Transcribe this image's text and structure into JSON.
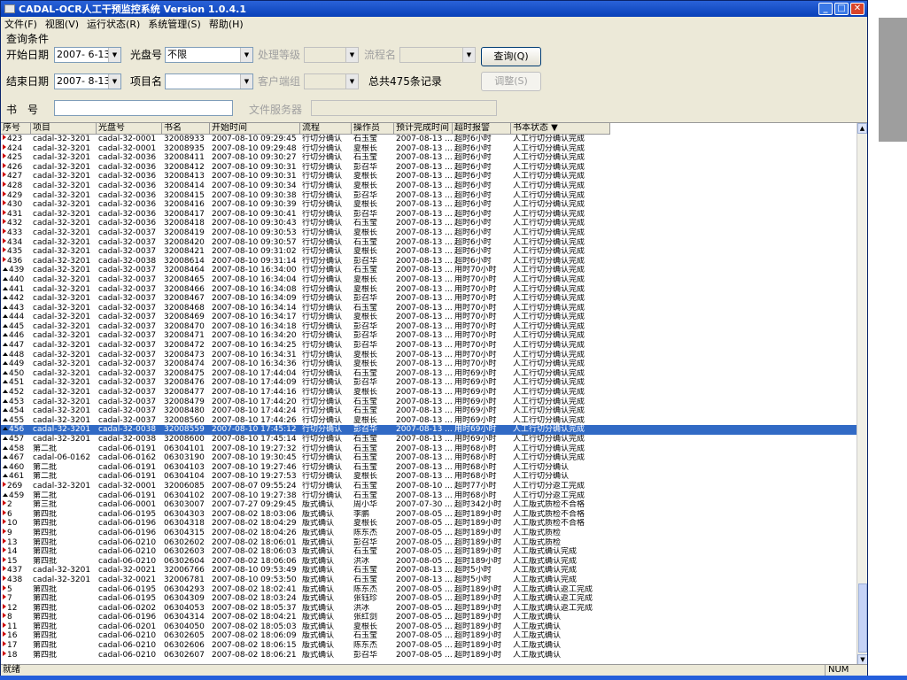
{
  "title": "CADAL-OCR人工干预监控系统 Version 1.0.4.1",
  "menu": [
    "文件(F)",
    "视图(V)",
    "运行状态(R)",
    "系统管理(S)",
    "帮助(H)"
  ],
  "query": {
    "section_label": "查询条件",
    "start_date_label": "开始日期",
    "start_date": "2007- 6-13",
    "disc_label": "光盘号",
    "disc_value": "不限",
    "level_label": "处理等级",
    "flow_label": "流程名",
    "query_button": "查询(Q)",
    "end_date_label": "结束日期",
    "end_date": "2007- 8-13",
    "project_label": "项目名",
    "client_label": "客户端组",
    "total_text": "总共475条记录",
    "adjust_button": "调整(S)",
    "book_label": "书　号",
    "file_server_label": "文件服务器"
  },
  "table": {
    "columns": [
      "序号",
      "项目",
      "光盘号",
      "书名",
      "开始时间",
      "流程",
      "操作员",
      "预计完成时间",
      "超时报警",
      "书本状态 ▼"
    ],
    "rows": [
      [
        "423",
        "cadal-32-3201",
        "cadal-32-0001",
        "32008933",
        "2007-08-10 09:29:45",
        "行切分确认",
        "石玉莹",
        "2007-08-13 ...",
        "超时6小时",
        "人工行切分确认完成",
        "r"
      ],
      [
        "424",
        "cadal-32-3201",
        "cadal-32-0001",
        "32008935",
        "2007-08-10 09:29:48",
        "行切分确认",
        "夏根长",
        "2007-08-13 ...",
        "超时6小时",
        "人工行切分确认完成",
        "r"
      ],
      [
        "425",
        "cadal-32-3201",
        "cadal-32-0036",
        "32008411",
        "2007-08-10 09:30:27",
        "行切分确认",
        "石玉莹",
        "2007-08-13 ...",
        "超时6小时",
        "人工行切分确认完成",
        "r"
      ],
      [
        "426",
        "cadal-32-3201",
        "cadal-32-0036",
        "32008412",
        "2007-08-10 09:30:31",
        "行切分确认",
        "彭召华",
        "2007-08-13 ...",
        "超时6小时",
        "人工行切分确认完成",
        "r"
      ],
      [
        "427",
        "cadal-32-3201",
        "cadal-32-0036",
        "32008413",
        "2007-08-10 09:30:31",
        "行切分确认",
        "夏根长",
        "2007-08-13 ...",
        "超时6小时",
        "人工行切分确认完成",
        "r"
      ],
      [
        "428",
        "cadal-32-3201",
        "cadal-32-0036",
        "32008414",
        "2007-08-10 09:30:34",
        "行切分确认",
        "夏根长",
        "2007-08-13 ...",
        "超时6小时",
        "人工行切分确认完成",
        "r"
      ],
      [
        "429",
        "cadal-32-3201",
        "cadal-32-0036",
        "32008415",
        "2007-08-10 09:30:38",
        "行切分确认",
        "彭召华",
        "2007-08-13 ...",
        "超时6小时",
        "人工行切分确认完成",
        "r"
      ],
      [
        "430",
        "cadal-32-3201",
        "cadal-32-0036",
        "32008416",
        "2007-08-10 09:30:39",
        "行切分确认",
        "夏根长",
        "2007-08-13 ...",
        "超时6小时",
        "人工行切分确认完成",
        "r"
      ],
      [
        "431",
        "cadal-32-3201",
        "cadal-32-0036",
        "32008417",
        "2007-08-10 09:30:41",
        "行切分确认",
        "彭召华",
        "2007-08-13 ...",
        "超时6小时",
        "人工行切分确认完成",
        "r"
      ],
      [
        "432",
        "cadal-32-3201",
        "cadal-32-0036",
        "32008418",
        "2007-08-10 09:30:43",
        "行切分确认",
        "石玉莹",
        "2007-08-13 ...",
        "超时6小时",
        "人工行切分确认完成",
        "r"
      ],
      [
        "433",
        "cadal-32-3201",
        "cadal-32-0037",
        "32008419",
        "2007-08-10 09:30:53",
        "行切分确认",
        "夏根长",
        "2007-08-13 ...",
        "超时6小时",
        "人工行切分确认完成",
        "r"
      ],
      [
        "434",
        "cadal-32-3201",
        "cadal-32-0037",
        "32008420",
        "2007-08-10 09:30:57",
        "行切分确认",
        "石玉莹",
        "2007-08-13 ...",
        "超时6小时",
        "人工行切分确认完成",
        "r"
      ],
      [
        "435",
        "cadal-32-3201",
        "cadal-32-0037",
        "32008421",
        "2007-08-10 09:31:02",
        "行切分确认",
        "夏根长",
        "2007-08-13 ...",
        "超时6小时",
        "人工行切分确认完成",
        "r"
      ],
      [
        "436",
        "cadal-32-3201",
        "cadal-32-0038",
        "32008614",
        "2007-08-10 09:31:14",
        "行切分确认",
        "彭召华",
        "2007-08-13 ...",
        "超时6小时",
        "人工行切分确认完成",
        "r"
      ],
      [
        "439",
        "cadal-32-3201",
        "cadal-32-0037",
        "32008464",
        "2007-08-10 16:34:00",
        "行切分确认",
        "石玉莹",
        "2007-08-13 ...",
        "用时70小时",
        "人工行切分确认完成",
        "u"
      ],
      [
        "440",
        "cadal-32-3201",
        "cadal-32-0037",
        "32008465",
        "2007-08-10 16:34:04",
        "行切分确认",
        "夏根长",
        "2007-08-13 ...",
        "用时70小时",
        "人工行切分确认完成",
        "u"
      ],
      [
        "441",
        "cadal-32-3201",
        "cadal-32-0037",
        "32008466",
        "2007-08-10 16:34:08",
        "行切分确认",
        "夏根长",
        "2007-08-13 ...",
        "用时70小时",
        "人工行切分确认完成",
        "u"
      ],
      [
        "442",
        "cadal-32-3201",
        "cadal-32-0037",
        "32008467",
        "2007-08-10 16:34:09",
        "行切分确认",
        "彭召华",
        "2007-08-13 ...",
        "用时70小时",
        "人工行切分确认完成",
        "u"
      ],
      [
        "443",
        "cadal-32-3201",
        "cadal-32-0037",
        "32008468",
        "2007-08-10 16:34:14",
        "行切分确认",
        "石玉莹",
        "2007-08-13 ...",
        "用时70小时",
        "人工行切分确认完成",
        "u"
      ],
      [
        "444",
        "cadal-32-3201",
        "cadal-32-0037",
        "32008469",
        "2007-08-10 16:34:17",
        "行切分确认",
        "夏根长",
        "2007-08-13 ...",
        "用时70小时",
        "人工行切分确认完成",
        "u"
      ],
      [
        "445",
        "cadal-32-3201",
        "cadal-32-0037",
        "32008470",
        "2007-08-10 16:34:18",
        "行切分确认",
        "彭召华",
        "2007-08-13 ...",
        "用时70小时",
        "人工行切分确认完成",
        "u"
      ],
      [
        "446",
        "cadal-32-3201",
        "cadal-32-0037",
        "32008471",
        "2007-08-10 16:34:20",
        "行切分确认",
        "彭召华",
        "2007-08-13 ...",
        "用时70小时",
        "人工行切分确认完成",
        "u"
      ],
      [
        "447",
        "cadal-32-3201",
        "cadal-32-0037",
        "32008472",
        "2007-08-10 16:34:25",
        "行切分确认",
        "彭召华",
        "2007-08-13 ...",
        "用时70小时",
        "人工行切分确认完成",
        "u"
      ],
      [
        "448",
        "cadal-32-3201",
        "cadal-32-0037",
        "32008473",
        "2007-08-10 16:34:31",
        "行切分确认",
        "夏根长",
        "2007-08-13 ...",
        "用时70小时",
        "人工行切分确认完成",
        "u"
      ],
      [
        "449",
        "cadal-32-3201",
        "cadal-32-0037",
        "32008474",
        "2007-08-10 16:34:36",
        "行切分确认",
        "夏根长",
        "2007-08-13 ...",
        "用时70小时",
        "人工行切分确认完成",
        "u"
      ],
      [
        "450",
        "cadal-32-3201",
        "cadal-32-0037",
        "32008475",
        "2007-08-10 17:44:04",
        "行切分确认",
        "石玉莹",
        "2007-08-13 ...",
        "用时69小时",
        "人工行切分确认完成",
        "u"
      ],
      [
        "451",
        "cadal-32-3201",
        "cadal-32-0037",
        "32008476",
        "2007-08-10 17:44:09",
        "行切分确认",
        "彭召华",
        "2007-08-13 ...",
        "用时69小时",
        "人工行切分确认完成",
        "u"
      ],
      [
        "452",
        "cadal-32-3201",
        "cadal-32-0037",
        "32008477",
        "2007-08-10 17:44:16",
        "行切分确认",
        "夏根长",
        "2007-08-13 ...",
        "用时69小时",
        "人工行切分确认完成",
        "u"
      ],
      [
        "453",
        "cadal-32-3201",
        "cadal-32-0037",
        "32008479",
        "2007-08-10 17:44:20",
        "行切分确认",
        "石玉莹",
        "2007-08-13 ...",
        "用时69小时",
        "人工行切分确认完成",
        "u"
      ],
      [
        "454",
        "cadal-32-3201",
        "cadal-32-0037",
        "32008480",
        "2007-08-10 17:44:24",
        "行切分确认",
        "石玉莹",
        "2007-08-13 ...",
        "用时69小时",
        "人工行切分确认完成",
        "u"
      ],
      [
        "455",
        "cadal-32-3201",
        "cadal-32-0037",
        "32008560",
        "2007-08-10 17:44:26",
        "行切分确认",
        "夏根长",
        "2007-08-13 ...",
        "用时69小时",
        "人工行切分确认完成",
        "u"
      ],
      [
        "456",
        "cadal-32-3201",
        "cadal-32-0038",
        "32008559",
        "2007-08-10 17:45:12",
        "行切分确认",
        "彭召华",
        "2007-08-13 ...",
        "用时69小时",
        "人工行切分确认完成",
        "u"
      ],
      [
        "457",
        "cadal-32-3201",
        "cadal-32-0038",
        "32008600",
        "2007-08-10 17:45:14",
        "行切分确认",
        "石玉莹",
        "2007-08-13 ...",
        "用时69小时",
        "人工行切分确认完成",
        "u"
      ],
      [
        "458",
        "第二批",
        "cadal-06-0191",
        "06304101",
        "2007-08-10 19:27:32",
        "行切分确认",
        "石玉莹",
        "2007-08-13 ...",
        "用时68小时",
        "人工行切分确认完成",
        "u"
      ],
      [
        "467",
        "cadal-06-0162",
        "cadal-06-0162",
        "06303190",
        "2007-08-10 19:30:45",
        "行切分确认",
        "石玉莹",
        "2007-08-13 ...",
        "用时68小时",
        "人工行切分确认完成",
        "u"
      ],
      [
        "460",
        "第二批",
        "cadal-06-0191",
        "06304103",
        "2007-08-10 19:27:46",
        "行切分确认",
        "石玉莹",
        "2007-08-13 ...",
        "用时68小时",
        "人工行切分确认",
        "u"
      ],
      [
        "461",
        "第二批",
        "cadal-06-0191",
        "06304104",
        "2007-08-10 19:27:53",
        "行切分确认",
        "夏根长",
        "2007-08-13 ...",
        "用时68小时",
        "人工行切分确认",
        "u"
      ],
      [
        "269",
        "cadal-32-3201",
        "cadal-32-0001",
        "32006085",
        "2007-08-07 09:55:24",
        "行切分确认",
        "石玉莹",
        "2007-08-10 ...",
        "超时77小时",
        "人工行切分返工完成",
        "r"
      ],
      [
        "459",
        "第二批",
        "cadal-06-0191",
        "06304102",
        "2007-08-10 19:27:38",
        "行切分确认",
        "石玉莹",
        "2007-08-13 ...",
        "用时68小时",
        "人工行切分返工完成",
        "u"
      ],
      [
        "2",
        "第三批",
        "cadal-06-0001",
        "06303007",
        "2007-07-27 09:29:45",
        "版式确认",
        "周小华",
        "2007-07-30 ...",
        "超时342小时",
        "人工版式质检不合格",
        "r"
      ],
      [
        "6",
        "第四批",
        "cadal-06-0195",
        "06304303",
        "2007-08-02 18:03:06",
        "版式确认",
        "李鹏",
        "2007-08-05 ...",
        "超时189小时",
        "人工版式质检不合格",
        "r"
      ],
      [
        "10",
        "第四批",
        "cadal-06-0196",
        "06304318",
        "2007-08-02 18:04:29",
        "版式确认",
        "夏根长",
        "2007-08-05 ...",
        "超时189小时",
        "人工版式质检不合格",
        "r"
      ],
      [
        "9",
        "第四批",
        "cadal-06-0196",
        "06304315",
        "2007-08-02 18:04:26",
        "版式确认",
        "陈东杰",
        "2007-08-05 ...",
        "超时189小时",
        "人工版式质检",
        "r"
      ],
      [
        "13",
        "第四批",
        "cadal-06-0210",
        "06302602",
        "2007-08-02 18:06:01",
        "版式确认",
        "彭召华",
        "2007-08-05 ...",
        "超时189小时",
        "人工版式质检",
        "r"
      ],
      [
        "14",
        "第四批",
        "cadal-06-0210",
        "06302603",
        "2007-08-02 18:06:03",
        "版式确认",
        "石玉莹",
        "2007-08-05 ...",
        "超时189小时",
        "人工版式确认完成",
        "r"
      ],
      [
        "15",
        "第四批",
        "cadal-06-0210",
        "06302604",
        "2007-08-02 18:06:06",
        "版式确认",
        "洪冰",
        "2007-08-05 ...",
        "超时189小时",
        "人工版式确认完成",
        "r"
      ],
      [
        "437",
        "cadal-32-3201",
        "cadal-32-0021",
        "32006766",
        "2007-08-10 09:53:49",
        "版式确认",
        "石玉莹",
        "2007-08-13 ...",
        "超时5小时",
        "人工版式确认完成",
        "r"
      ],
      [
        "438",
        "cadal-32-3201",
        "cadal-32-0021",
        "32006781",
        "2007-08-10 09:53:50",
        "版式确认",
        "石玉莹",
        "2007-08-13 ...",
        "超时5小时",
        "人工版式确认完成",
        "r"
      ],
      [
        "5",
        "第四批",
        "cadal-06-0195",
        "06304293",
        "2007-08-02 18:02:41",
        "版式确认",
        "陈东杰",
        "2007-08-05 ...",
        "超时189小时",
        "人工版式确认返工完成",
        "r"
      ],
      [
        "7",
        "第四批",
        "cadal-06-0195",
        "06304309",
        "2007-08-02 18:03:24",
        "版式确认",
        "张钰珍",
        "2007-08-05 ...",
        "超时189小时",
        "人工版式确认返工完成",
        "r"
      ],
      [
        "12",
        "第四批",
        "cadal-06-0202",
        "06304053",
        "2007-08-02 18:05:37",
        "版式确认",
        "洪冰",
        "2007-08-05 ...",
        "超时189小时",
        "人工版式确认返工完成",
        "r"
      ],
      [
        "8",
        "第四批",
        "cadal-06-0196",
        "06304314",
        "2007-08-02 18:04:21",
        "版式确认",
        "张红剑",
        "2007-08-05 ...",
        "超时189小时",
        "人工版式确认",
        "r"
      ],
      [
        "11",
        "第四批",
        "cadal-06-0201",
        "06304050",
        "2007-08-02 18:05:03",
        "版式确认",
        "夏根长",
        "2007-08-05 ...",
        "超时189小时",
        "人工版式确认",
        "r"
      ],
      [
        "16",
        "第四批",
        "cadal-06-0210",
        "06302605",
        "2007-08-02 18:06:09",
        "版式确认",
        "石玉莹",
        "2007-08-05 ...",
        "超时189小时",
        "人工版式确认",
        "r"
      ],
      [
        "17",
        "第四批",
        "cadal-06-0210",
        "06302606",
        "2007-08-02 18:06:15",
        "版式确认",
        "陈东杰",
        "2007-08-05 ...",
        "超时189小时",
        "人工版式确认",
        "r"
      ],
      [
        "18",
        "第四批",
        "cadal-06-0210",
        "06302607",
        "2007-08-02 18:06:21",
        "版式确认",
        "彭召华",
        "2007-08-05 ...",
        "超时189小时",
        "人工版式确认",
        "r"
      ]
    ],
    "selected_index": 31
  },
  "status": {
    "ready": "就绪",
    "num": "NUM"
  },
  "colors": {
    "title_bar": "#0840b8",
    "selection": "#316ac5",
    "marker_red": "#cc0000"
  }
}
